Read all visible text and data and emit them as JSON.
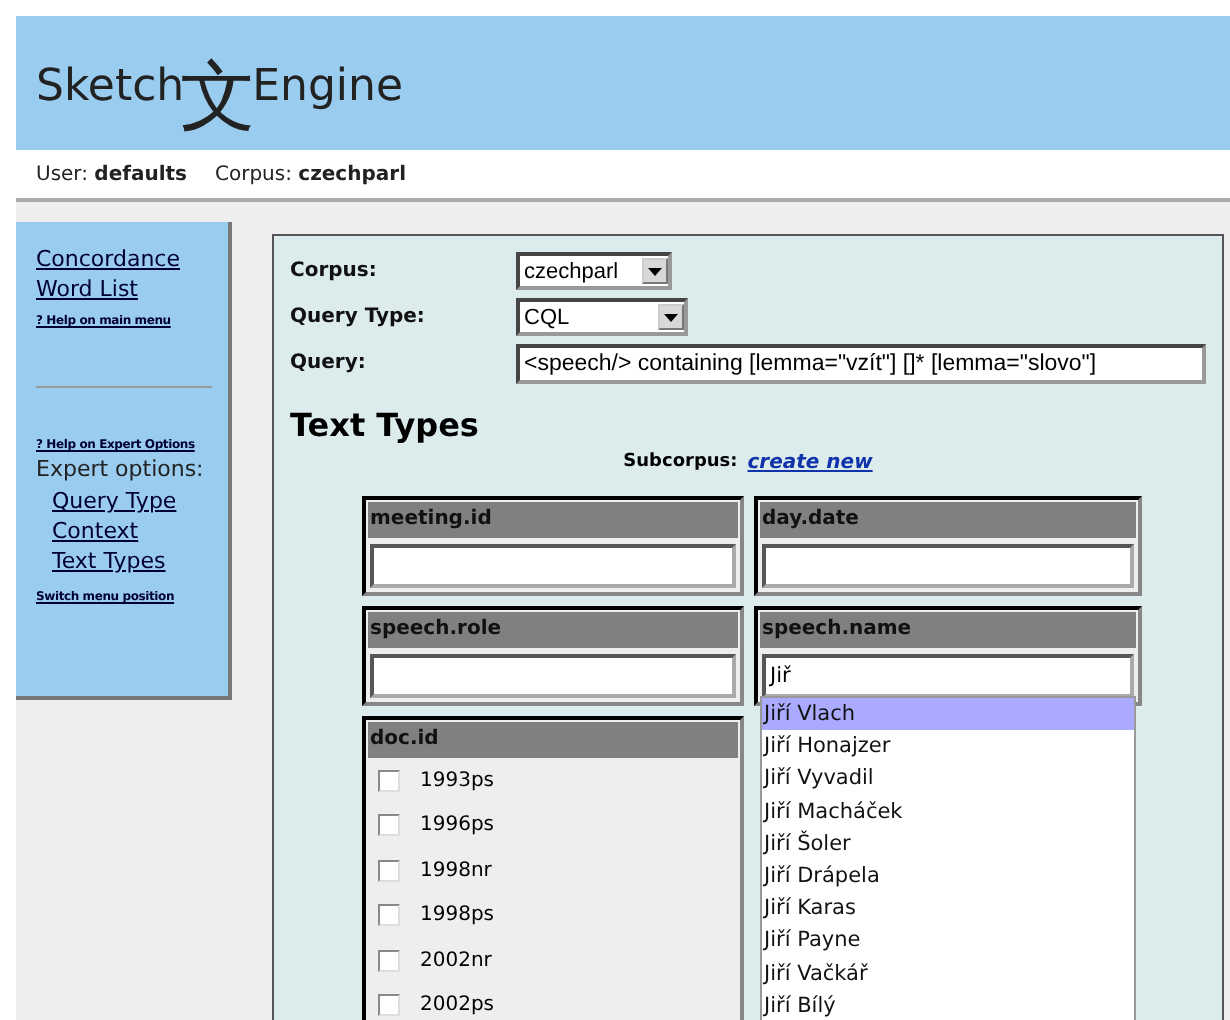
{
  "header": {
    "logo_left": "Sketch",
    "logo_mark": "文",
    "logo_right": "Engine"
  },
  "user_bar": {
    "user": "User: **defaults**",
    "corpus": "Corpus: **czechparl**"
  },
  "sidebar": {
    "main_links": [
      "Concordance",
      "Word List"
    ],
    "help_main": "? Help on main menu",
    "help_expert": "? Help on Expert Options",
    "expert_label": "Expert options:",
    "expert_links": [
      "Query Type",
      "Context",
      "Text Types"
    ],
    "switch": "Switch menu position"
  },
  "form": {
    "fields": [
      {
        "kind": "select",
        "label": "Corpus:",
        "value": "czechparl"
      },
      {
        "kind": "select",
        "label": "Query Type:",
        "value": "CQL"
      },
      {
        "kind": "text",
        "label": "Query:",
        "value": "<speech/> containing [lemma=\"vzít\"] []* [lemma=\"slovo\"]"
      }
    ]
  },
  "text_types": {
    "title": "Text Types",
    "subcorpus_label": "Subcorpus:",
    "subcorpus_link": "create new",
    "columns": [
      {
        "attributes": [
          {
            "kind": "text",
            "name": "meeting.id"
          },
          {
            "kind": "text",
            "name": "speech.role"
          },
          {
            "kind": "checklist",
            "name": "doc.id",
            "options": [
              {
                "label": "1993ps",
                "checked": false
              },
              {
                "label": "1996ps",
                "checked": false
              },
              {
                "label": "1998nr",
                "checked": false
              },
              {
                "label": "1998ps",
                "checked": false
              },
              {
                "label": "2002nr",
                "checked": false
              },
              {
                "label": "2002ps",
                "checked": false
              }
            ]
          }
        ]
      },
      {
        "attributes": [
          {
            "kind": "text",
            "name": "day.date"
          },
          {
            "kind": "text",
            "name": "speech.name",
            "value": "Jiř",
            "suggestions": [
              {
                "label": "Jiří Vlach",
                "selected": true
              },
              {
                "label": "Jiří Honajzer",
                "selected": false
              },
              {
                "label": "Jiří Vyvadil",
                "selected": false
              },
              {
                "label": "Jiří Macháček",
                "selected": false
              },
              {
                "label": "Jiří Šoler",
                "selected": false
              },
              {
                "label": "Jiří Drápela",
                "selected": false
              },
              {
                "label": "Jiří Karas",
                "selected": false
              },
              {
                "label": "Jiří Payne",
                "selected": false
              },
              {
                "label": "Jiří Vačkář",
                "selected": false
              },
              {
                "label": "Jiří Bílý",
                "selected": false
              }
            ]
          }
        ]
      }
    ]
  }
}
